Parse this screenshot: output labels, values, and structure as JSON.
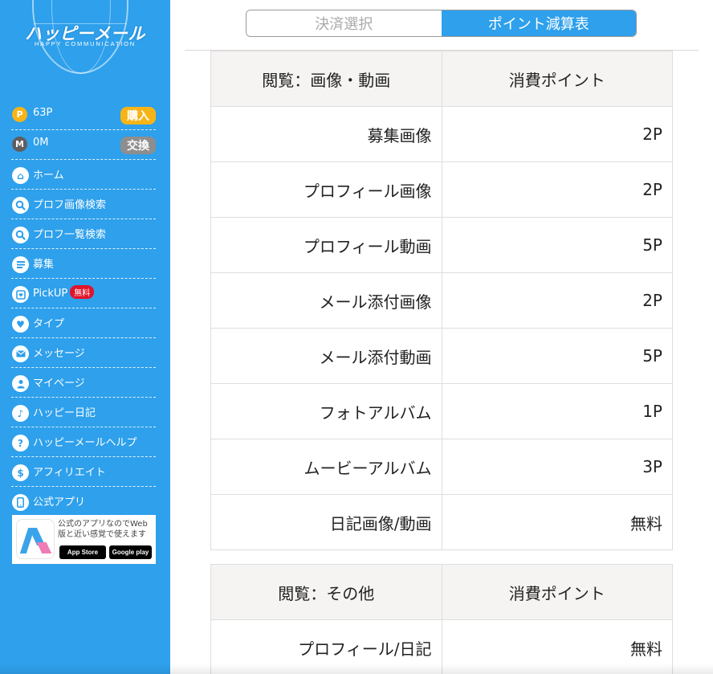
{
  "sidebar": {
    "logo_text": "ハッピーメール",
    "logo_sub": "HAPPY COMMUNICATION",
    "points": {
      "icon_letter": "P",
      "value": "63P",
      "button": "購入"
    },
    "mail": {
      "icon_letter": "M",
      "value": "0M",
      "button": "交換"
    },
    "items": [
      {
        "label": "ホーム",
        "icon": "home-icon"
      },
      {
        "label": "プロフ画像検索",
        "icon": "search-icon"
      },
      {
        "label": "プロフ一覧検索",
        "icon": "search-icon"
      },
      {
        "label": "募集",
        "icon": "list-icon"
      },
      {
        "label": "PickUP",
        "badge": "無料",
        "icon": "pickup-icon"
      },
      {
        "label": "タイプ",
        "icon": "heart-icon"
      },
      {
        "label": "メッセージ",
        "icon": "mail-icon"
      },
      {
        "label": "マイページ",
        "icon": "user-icon"
      },
      {
        "label": "ハッピー日記",
        "icon": "music-note-icon"
      },
      {
        "label": "ハッピーメールヘルプ",
        "icon": "help-icon"
      },
      {
        "label": "アフィリエイト",
        "icon": "dollar-icon"
      },
      {
        "label": "公式アプリ",
        "icon": "phone-icon"
      }
    ],
    "app_banner": {
      "description": "公式のアプリなのでWeb版と近い感覚で使えます",
      "app_store": "App Store",
      "google_play": "Google play"
    }
  },
  "tabs": [
    {
      "label": "決済選択",
      "active": false
    },
    {
      "label": "ポイント減算表",
      "active": true
    }
  ],
  "tables": [
    {
      "header": [
        "閲覧：画像・動画",
        "消費ポイント"
      ],
      "rows": [
        [
          "募集画像",
          "2P"
        ],
        [
          "プロフィール画像",
          "2P"
        ],
        [
          "プロフィール動画",
          "5P"
        ],
        [
          "メール添付画像",
          "2P"
        ],
        [
          "メール添付動画",
          "5P"
        ],
        [
          "フォトアルバム",
          "1P"
        ],
        [
          "ムービーアルバム",
          "3P"
        ],
        [
          "日記画像/動画",
          "無料"
        ]
      ]
    },
    {
      "header": [
        "閲覧：その他",
        "消費ポイント"
      ],
      "rows": [
        [
          "プロフィール/日記",
          "無料"
        ]
      ]
    }
  ],
  "colors": {
    "brand_blue": "#2ea0ec",
    "points_orange": "#f7b417",
    "free_badge_red": "#e0142a",
    "header_bg": "#f5f4f2"
  }
}
